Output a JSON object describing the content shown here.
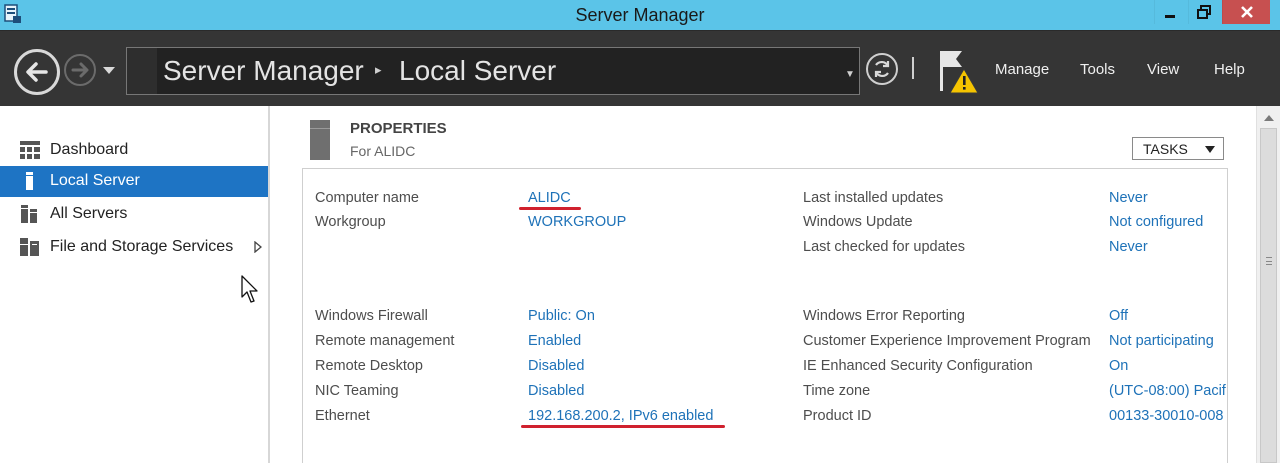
{
  "window": {
    "title": "Server Manager",
    "controls": [
      "minimize",
      "maximize",
      "close"
    ]
  },
  "header": {
    "breadcrumb_root": "Server Manager",
    "breadcrumb_separator": "▸",
    "breadcrumb_current": "Local Server",
    "menus": {
      "manage": "Manage",
      "tools": "Tools",
      "view": "View",
      "help": "Help"
    },
    "notification_icon": "flag-warning-icon"
  },
  "sidebar": {
    "items": [
      {
        "label": "Dashboard",
        "icon": "dashboard-icon",
        "selected": false
      },
      {
        "label": "Local Server",
        "icon": "local-server-icon",
        "selected": true
      },
      {
        "label": "All Servers",
        "icon": "all-servers-icon",
        "selected": false
      },
      {
        "label": "File and Storage Services",
        "icon": "file-storage-icon",
        "selected": false,
        "has_submenu": true
      }
    ]
  },
  "properties": {
    "title": "PROPERTIES",
    "subtitle": "For ALIDC",
    "tasks_label": "TASKS",
    "left_group_1": [
      {
        "label": "Computer name",
        "value": "ALIDC"
      },
      {
        "label": "Workgroup",
        "value": "WORKGROUP"
      }
    ],
    "right_group_1": [
      {
        "label": "Last installed updates",
        "value": "Never"
      },
      {
        "label": "Windows Update",
        "value": "Not configured"
      },
      {
        "label": "Last checked for updates",
        "value": "Never"
      }
    ],
    "left_group_2": [
      {
        "label": "Windows Firewall",
        "value": "Public: On"
      },
      {
        "label": "Remote management",
        "value": "Enabled"
      },
      {
        "label": "Remote Desktop",
        "value": "Disabled"
      },
      {
        "label": "NIC Teaming",
        "value": "Disabled"
      },
      {
        "label": "Ethernet",
        "value": "192.168.200.2, IPv6 enabled"
      }
    ],
    "right_group_2": [
      {
        "label": "Windows Error Reporting",
        "value": "Off"
      },
      {
        "label": "Customer Experience Improvement Program",
        "value": "Not participating"
      },
      {
        "label": "IE Enhanced Security Configuration",
        "value": "On"
      },
      {
        "label": "Time zone",
        "value": "(UTC-08:00) Pacif"
      },
      {
        "label": "Product ID",
        "value": "00133-30010-008"
      }
    ]
  },
  "colors": {
    "titlebar": "#5bc4e8",
    "header": "#353535",
    "selected": "#1e74c4",
    "link": "#1e72b8",
    "annotation": "#d0212e"
  }
}
